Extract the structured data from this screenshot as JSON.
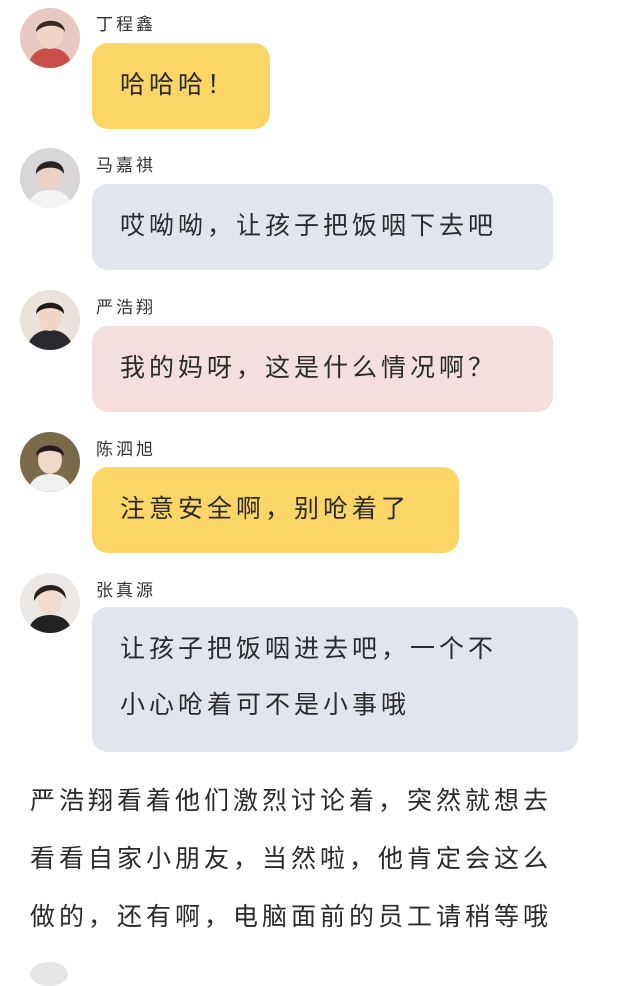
{
  "messages": [
    {
      "name": "丁程鑫",
      "text": "哈哈哈！",
      "color": "#fbd667"
    },
    {
      "name": "马嘉祺",
      "text": "哎呦呦，让孩子把饭咽下去吧",
      "color": "#e0e5ee"
    },
    {
      "name": "严浩翔",
      "text": "我的妈呀，这是什么情况啊？",
      "color": "#f4dede"
    },
    {
      "name": "陈泗旭",
      "text": "注意安全啊，别呛着了",
      "color": "#fbd667"
    },
    {
      "name": "张真源",
      "text_line1": "让孩子把饭咽进去吧，一个不",
      "text_line2": "小心呛着可不是小事哦",
      "color": "#e0e5ee"
    }
  ],
  "story": {
    "line1": "严浩翔看着他们激烈讨论着，突然就想去",
    "line2": "看看自家小朋友，当然啦，他肯定会这么",
    "line3": "做的，还有啊，电脑面前的员工请稍等哦"
  }
}
